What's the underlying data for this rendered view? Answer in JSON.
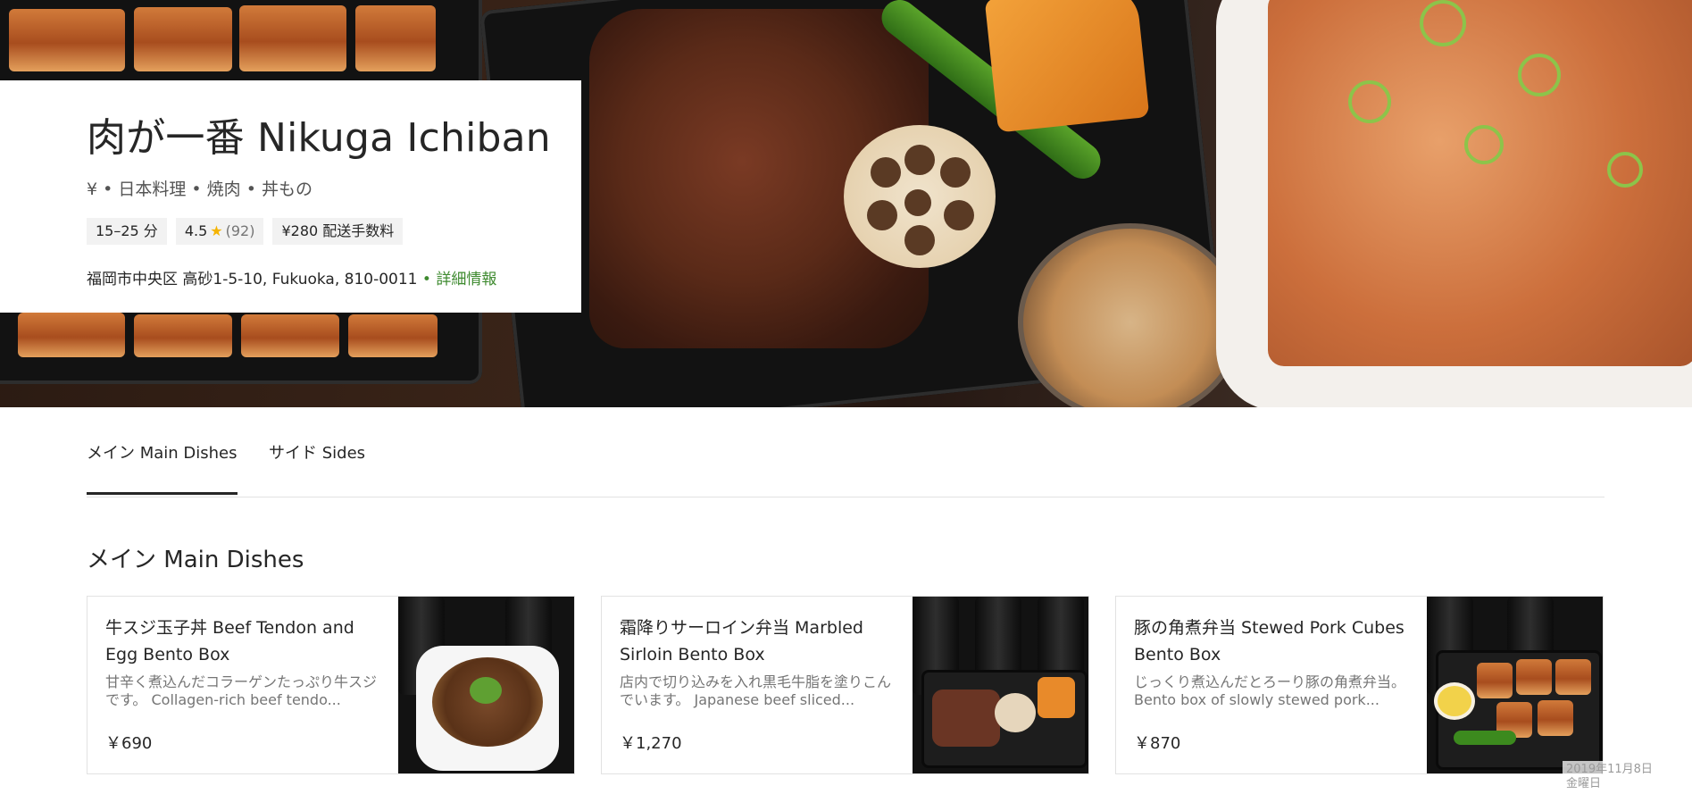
{
  "restaurant": {
    "name": "肉が一番 Nikuga Ichiban",
    "categories": "¥ • 日本料理 • 焼肉 • 丼もの",
    "eta": "15–25 分",
    "rating": "4.5",
    "rating_count": "(92)",
    "delivery_fee": "¥280 配送手数料",
    "address": "福岡市中央区 高砂1-5-10, Fukuoka, 810-0011",
    "separator": "•",
    "details_link": "詳細情報"
  },
  "tabs": [
    {
      "label": "メイン Main Dishes",
      "active": true
    },
    {
      "label": "サイド Sides",
      "active": false
    }
  ],
  "section": {
    "title": "メイン Main Dishes"
  },
  "items": [
    {
      "title": "牛スジ玉子丼 Beef Tendon and Egg Bento Box",
      "desc": "甘辛く煮込んだコラーゲンたっぷり牛スジです。 Collagen-rich beef tendo...",
      "price": "￥690"
    },
    {
      "title": "霜降りサーロイン弁当 Marbled Sirloin Bento Box",
      "desc": "店内で切り込みを入れ黒毛牛脂を塗りこんでいます。 Japanese beef sliced...",
      "price": "￥1,270"
    },
    {
      "title": "豚の角煮弁当 Stewed Pork Cubes Bento Box",
      "desc": "じっくり煮込んだとろーり豚の角煮弁当。 Bento box of slowly stewed pork...",
      "price": "￥870"
    }
  ],
  "datestamp": {
    "line1": "2019年11月8日",
    "line2": "金曜日"
  },
  "colors": {
    "link": "#3e8a2f",
    "star": "#f5b400",
    "text": "#262626",
    "muted": "#757575"
  },
  "icons": {
    "star": "star-icon"
  }
}
